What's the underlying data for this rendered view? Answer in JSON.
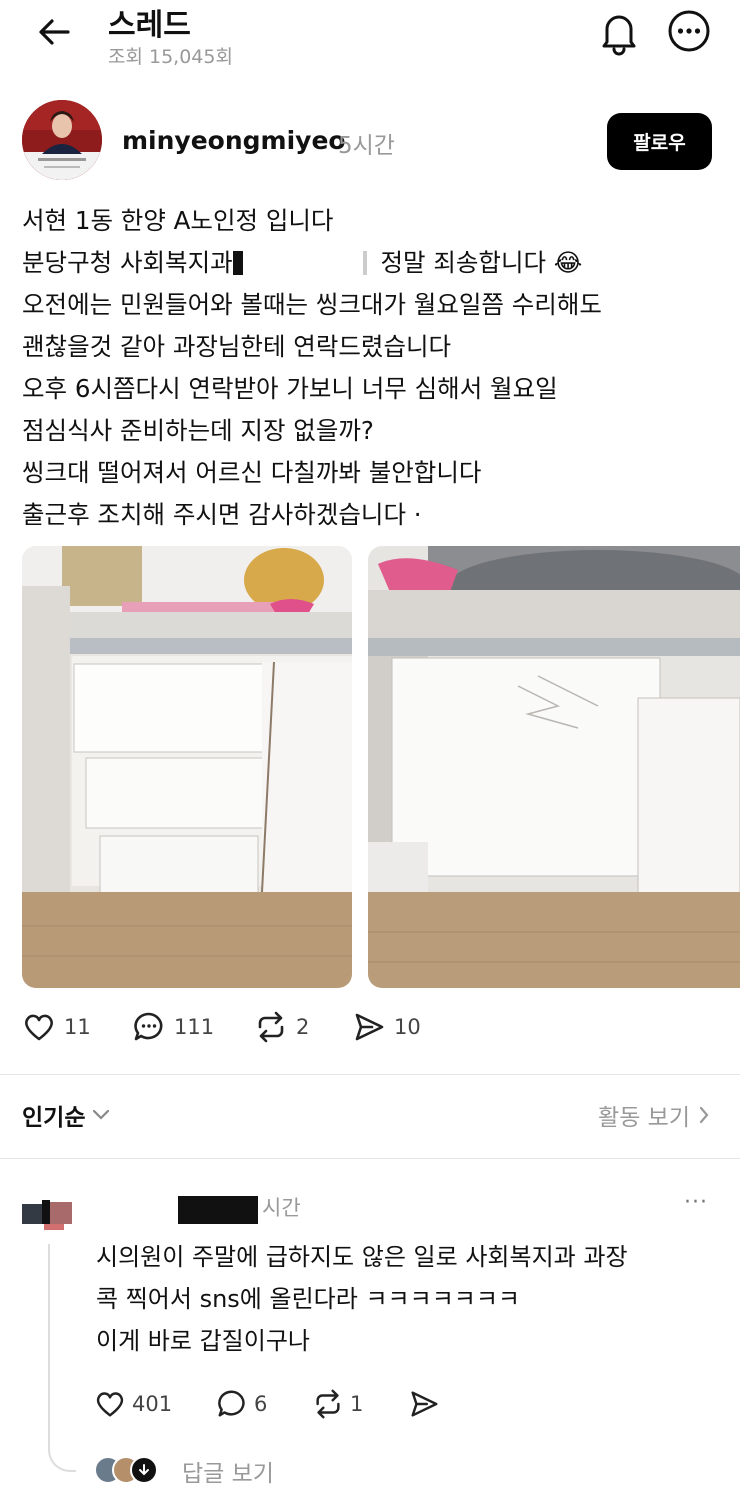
{
  "header": {
    "title": "스레드",
    "views": "조회 15,045회"
  },
  "post": {
    "username": "minyeongmiyeo",
    "time": "5시간",
    "follow_label": "팔로우",
    "lines": [
      "서현 1동 한양 A노인정 입니다",
      "분당구청 사회복지과",
      "정말 죄송합니다 😂",
      "오전에는 민원들어와 볼때는 씽크대가 월요일쯤 수리해도",
      "괜찮을것 같아 과장님한테 연락드렸습니다",
      "오후 6시쯤다시 연락받아 가보니 너무 심해서 월요일",
      "점심식사 준비하는데 지장 없을까?",
      "씽크대 떨어져서 어르신 다칠까봐 불안합니다",
      "출근후 조치해 주시면 감사하겠습니다 ·"
    ],
    "likes": "11",
    "comments": "111",
    "reposts": "2",
    "shares": "10"
  },
  "sort": {
    "label": "인기순",
    "activity_label": "활동 보기"
  },
  "comment": {
    "time": "시간",
    "more": "···",
    "lines": [
      "시의원이 주말에 급하지도 않은 일로 사회복지과 과장",
      "콕 찍어서 sns에 올린다라 ㅋㅋㅋㅋㅋㅋㅋ",
      "이게 바로 갑질이구나"
    ],
    "likes": "401",
    "replies": "6",
    "reposts": "1",
    "view_replies": "답글 보기"
  },
  "colors": {
    "accent": "#000000",
    "muted": "#999999",
    "divider": "#e6e6e6"
  }
}
